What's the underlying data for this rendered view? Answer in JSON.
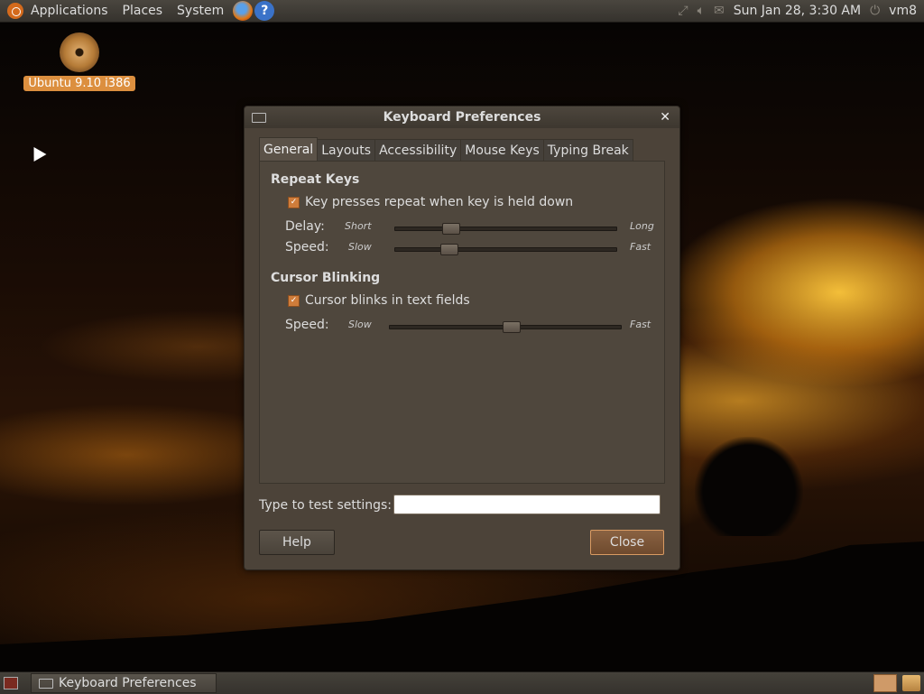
{
  "top_panel": {
    "applications": "Applications",
    "places": "Places",
    "system": "System",
    "help_glyph": "?",
    "clock": "Sun Jan 28,  3:30 AM",
    "user": "vm8",
    "icons": [
      "ubuntu-logo-icon",
      "firefox-icon",
      "help-icon",
      "network-icon",
      "volume-icon",
      "mail-icon",
      "power-icon"
    ]
  },
  "desktop": {
    "cd_label": "Ubuntu 9.10 i386"
  },
  "window": {
    "title": "Keyboard Preferences",
    "close_glyph": "✕",
    "tabs": [
      "General",
      "Layouts",
      "Accessibility",
      "Mouse Keys",
      "Typing Break"
    ],
    "active_tab": "General",
    "repeat_keys": {
      "title": "Repeat Keys",
      "checkbox_label": "Key presses repeat when key is held down",
      "checked": true,
      "delay": {
        "label": "Delay:",
        "min": "Short",
        "max": "Long",
        "value": 0.23
      },
      "speed": {
        "label": "Speed:",
        "min": "Slow",
        "max": "Fast",
        "value": 0.22
      }
    },
    "cursor_blinking": {
      "title": "Cursor Blinking",
      "checkbox_label": "Cursor blinks in text fields",
      "checked": true,
      "speed": {
        "label": "Speed:",
        "min": "Slow",
        "max": "Fast",
        "value": 0.53
      }
    },
    "test_label": "Type to test settings:",
    "test_value": "",
    "help_button": "Help",
    "close_button": "Close"
  },
  "bottom_panel": {
    "task_label": "Keyboard Preferences"
  },
  "colors": {
    "accent": "#cf7c3a",
    "window_bg": "#4c4339",
    "panel_bg": "#3d3a34"
  }
}
